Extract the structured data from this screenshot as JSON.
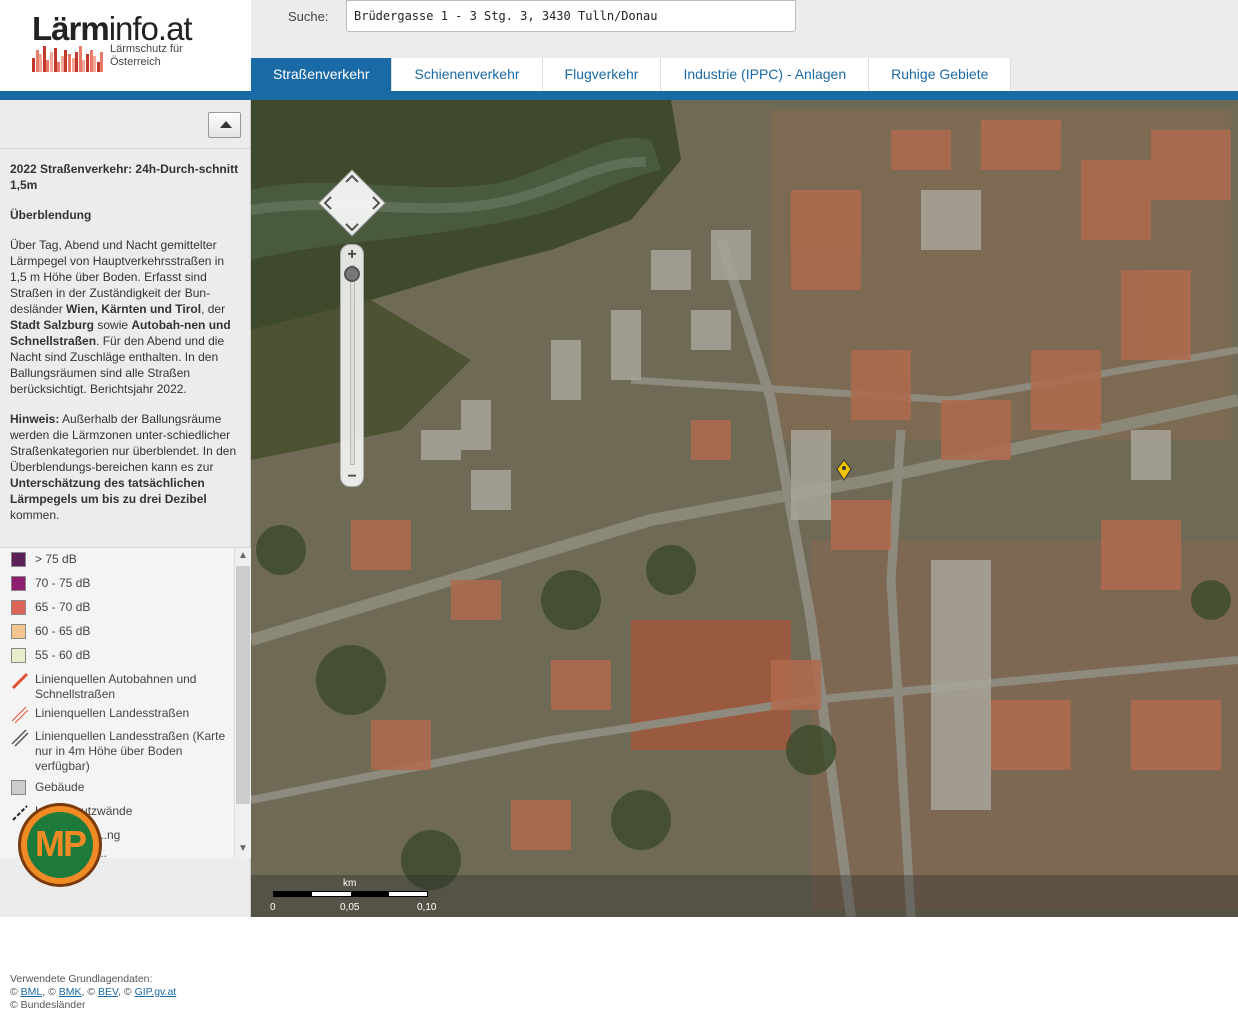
{
  "header": {
    "logo_main": "Lärm",
    "logo_rest": "info.at",
    "logo_sub_1": "Lärmschutz für",
    "logo_sub_2": "Österreich",
    "search_label": "Suche:",
    "search_value": "Brüdergasse 1 - 3 Stg. 3, 3430 Tulln/Donau"
  },
  "tabs": [
    {
      "label": "Straßenverkehr",
      "active": true
    },
    {
      "label": "Schienenverkehr",
      "active": false
    },
    {
      "label": "Flugverkehr",
      "active": false
    },
    {
      "label": "Industrie (IPPC) - Anlagen",
      "active": false
    },
    {
      "label": "Ruhige Gebiete",
      "active": false
    }
  ],
  "sidebar": {
    "layer_title": "2022 Straßenverkehr: 24h-Durch-schnitt 1,5m",
    "subhead": "Überblendung",
    "p1_a": "Über Tag, Abend und Nacht gemittelter Lärmpegel von Hauptverkehrsstraßen in 1,5 m Höhe über Boden. Erfasst sind Straßen in der Zuständigkeit der Bun-desländer ",
    "p1_b1": "Wien, Kärnten und Tirol",
    "p1_c": ", der ",
    "p1_b2": "Stadt Salzburg",
    "p1_d": " sowie ",
    "p1_b3": "Autobah-nen und Schnellstraßen",
    "p1_e": ". Für den Abend und die Nacht sind Zuschläge enthalten. In den Ballungsräumen sind alle Straßen berücksichtigt. Berichtsjahr 2022.",
    "p2_b1": "Hinweis:",
    "p2_a": " Außerhalb der Ballungsräume werden die Lärmzonen unter-schiedlicher Straßenkategorien nur überblendet. In den Überblendungs-bereichen kann es zur ",
    "p2_b2": "Unterschätzung des tatsächlichen Lärmpegels um bis zu drei Dezibel",
    "p2_c": " kommen."
  },
  "legend": [
    {
      "label": "> 75 dB",
      "color": "#5b2058"
    },
    {
      "label": "70 - 75 dB",
      "color": "#8e1e6e"
    },
    {
      "label": "65 - 70 dB",
      "color": "#dd6458"
    },
    {
      "label": "60 - 65 dB",
      "color": "#f5c58f"
    },
    {
      "label": "55 - 60 dB",
      "color": "#e6efc9"
    },
    {
      "label": "Linienquellen Autobahnen und Schnellstraßen"
    },
    {
      "label": "Linienquellen Landesstraßen"
    },
    {
      "label": "Linienquellen Landesstraßen (Karte nur in 4m Höhe über Boden verfügbar)"
    },
    {
      "label": "Gebäude",
      "color": "#cccccc"
    },
    {
      "label": "Lärmschutzwände"
    },
    {
      "label": "...ng"
    },
    {
      "label": "..."
    }
  ],
  "mp_logo": "MP",
  "credits": {
    "line1": "Verwendete Grundlagendaten:",
    "copy": "© ",
    "l1": "BML",
    "l2": "BMK",
    "l3": "BEV",
    "l4": "GIP.gv.at",
    "line3": "© Bundesländer"
  },
  "map": {
    "zoom_in": "+",
    "zoom_out": "−",
    "scale_unit": "km",
    "scale_ticks": [
      "0",
      "0,05",
      "0,10"
    ]
  }
}
